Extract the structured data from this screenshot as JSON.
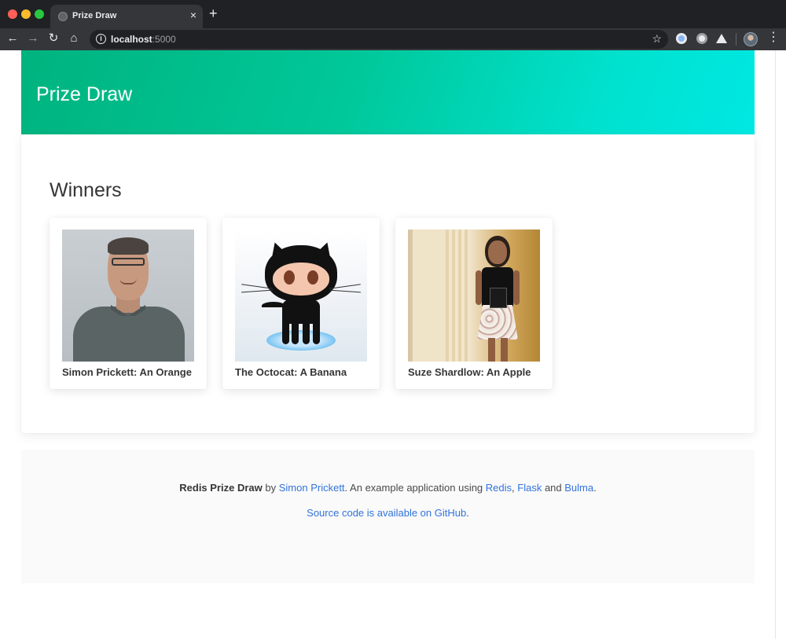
{
  "browser": {
    "tab_title": "Prize Draw",
    "tab_close": "×",
    "new_tab": "+",
    "url_host": "localhost",
    "url_port": ":5000",
    "info_glyph": "i",
    "star_glyph": "☆",
    "menu_glyph": "⋮",
    "nav": {
      "back": "←",
      "forward": "→",
      "reload": "↻",
      "home": "⌂"
    }
  },
  "hero": {
    "title": "Prize Draw"
  },
  "winners": {
    "heading": "Winners",
    "cards": [
      {
        "caption": "Simon Prickett: An Orange",
        "image": "portrait-photo"
      },
      {
        "caption": "The Octocat: A Banana",
        "image": "octocat-image"
      },
      {
        "caption": "Suze Shardlow: An Apple",
        "image": "portrait-photo"
      }
    ]
  },
  "footer": {
    "app_name": "Redis Prize Draw",
    "by": " by ",
    "author": "Simon Prickett",
    "middle": ". An example application using ",
    "redis": "Redis",
    "comma": ", ",
    "flask": "Flask",
    "and": " and ",
    "bulma": "Bulma",
    "period": ".",
    "source_link": "Source code is available on GitHub",
    "source_period": "."
  },
  "colors": {
    "hero_start": "#00b37e",
    "hero_end": "#00e8e3",
    "link": "#3273dc",
    "chrome_dark": "#202124"
  }
}
